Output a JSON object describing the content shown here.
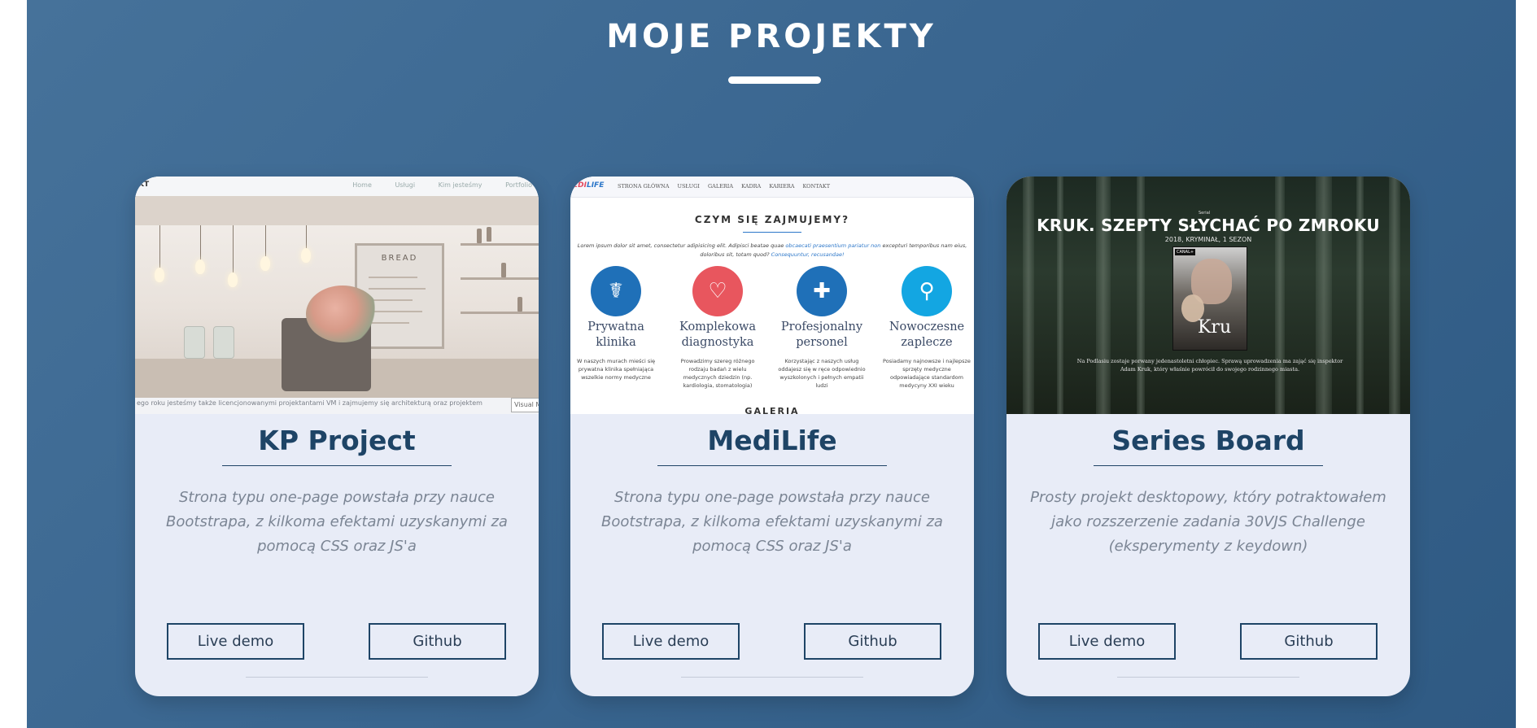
{
  "section": {
    "title": "MOJE PROJEKTY"
  },
  "projects": [
    {
      "title": "KP Project",
      "description": "Strona typu one-page powstała przy nauce Bootstrapa, z kilkoma efektami uzyskanymi za pomocą CSS oraz JS'a",
      "live_label": "Live demo",
      "github_label": "Github",
      "preview": {
        "logo": "KT",
        "nav": [
          "Home",
          "Usługi",
          "Kim jesteśmy",
          "Portfolio"
        ],
        "board_text": "BREAD",
        "strip_text": "ego roku jesteśmy także licencjonowanymi projektantami VM i zajmujemy się architekturą oraz projektem",
        "strip_button": "Visual M"
      }
    },
    {
      "title": "MediLife",
      "description": "Strona typu one-page powstała przy nauce Bootstrapa, z kilkoma efektami uzyskanymi za pomocą CSS oraz JS'a",
      "live_label": "Live demo",
      "github_label": "Github",
      "preview": {
        "logo_a": "EDI",
        "logo_b": "LIFE",
        "nav": [
          "STRONA GŁÓWNA",
          "USŁUGI",
          "GALERIA",
          "KADRA",
          "KARIERA",
          "KONTAKT"
        ],
        "heading": "CZYM SIĘ ZAJMUJEMY?",
        "lorem_a": "Lorem ipsum dolor sit amet, consectetur adipisicing elit. Adipisci beatae quae ",
        "lorem_link": "obcaecati praesentium pariatur non",
        "lorem_b": " excepturi temporibus nam eius, doloribus sit, totam quod? ",
        "lorem_link2": "Consequuntur, recusandae!",
        "features": [
          {
            "icon": "caduceus-icon",
            "glyph": "☤",
            "color": "#1f70b8",
            "name": "Prywatna klinika",
            "desc": "W naszych murach mieści się prywatna klinika spełniająca wszelkie normy medyczne"
          },
          {
            "icon": "heart-pulse-icon",
            "glyph": "♡",
            "color": "#e8565e",
            "name": "Komplekowa diagnostyka",
            "desc": "Prowadzimy szereg różnego rodzaju badań z wielu medycznych dziedzin (np. kardiologia, stomatologia)"
          },
          {
            "icon": "nurse-icon",
            "glyph": "✚",
            "color": "#1f70b8",
            "name": "Profesjonalny personel",
            "desc": "Korzystając z naszych usług oddajesz się w ręce odpowiednio wyszkolonych i pełnych empatii ludzi"
          },
          {
            "icon": "microscope-icon",
            "glyph": "⚲",
            "color": "#13a6e2",
            "name": "Nowoczesne zaplecze",
            "desc": "Posiadamy najnowsze i najlepsze sprzęty medyczne odpowiadające standardom medycyny XXI wieku"
          }
        ],
        "gallery": "GALERIA"
      }
    },
    {
      "title": "Series Board",
      "description": "Prosty projekt desktopowy, który potraktowałem jako rozszerzenie zadania 30VJS Challenge (eksperymenty z keydown)",
      "live_label": "Live demo",
      "github_label": "Github",
      "preview": {
        "tiny": "Serial",
        "title": "KRUK. SZEPTY SŁYCHAĆ PO ZMROKU",
        "sub": "2018, KRYMINAŁ, 1 SEZON",
        "poster_logo": "CANAL+",
        "poster_word": "Kru",
        "desc": "Na Podlasiu zostaje porwany jedenastoletni chłopiec. Sprawą uprowadzenia ma zająć się inspektor Adam Kruk, który właśnie powrócił do swojego rodzinnego miasta."
      }
    }
  ]
}
